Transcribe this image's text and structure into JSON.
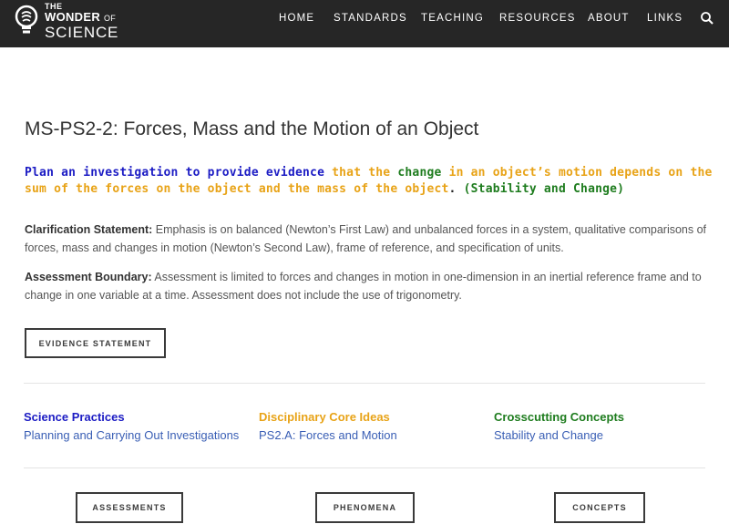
{
  "header": {
    "logo": {
      "line1": "THE",
      "line2": "WONDER",
      "line2_of": "OF",
      "line3": "SCIENCE"
    },
    "nav": [
      {
        "label": "HOME"
      },
      {
        "label": "STANDARDS"
      },
      {
        "label": "TEACHING"
      },
      {
        "label": "RESOURCES"
      },
      {
        "label": "ABOUT"
      },
      {
        "label": "LINKS"
      }
    ],
    "search_icon": "search-icon"
  },
  "page": {
    "title": "MS-PS2-2: Forces, Mass and the Motion of an Object",
    "performance_expectation": {
      "part1": "Plan an investigation to provide evidence",
      "part2": " that the ",
      "part3": "change",
      "part4": " in an object’s motion depends on the sum of the forces on the object and the mass of the object",
      "part5": ". ",
      "part6": "(Stability and Change)"
    },
    "clarification": {
      "label": "Clarification Statement:",
      "text": " Emphasis is on balanced (Newton’s First Law) and unbalanced forces in a system, qualitative comparisons of forces, mass and changes in motion (Newton’s Second Law), frame of reference, and specification of units."
    },
    "assessment_boundary": {
      "label": "Assessment Boundary:",
      "text": " Assessment is limited to forces and changes in motion in one-dimension in an inertial reference frame and to change in one variable at a time. Assessment does not include the use of trigonometry."
    },
    "evidence_button": "EVIDENCE STATEMENT",
    "columns": [
      {
        "heading": "Science Practices",
        "link": "Planning and Carrying Out Investigations",
        "color": "#1c1cc4"
      },
      {
        "heading": "Disciplinary Core Ideas",
        "link": "PS2.A: Forces and Motion",
        "color": "#e8a317"
      },
      {
        "heading": "Crosscutting Concepts",
        "link": "Stability and Change",
        "color": "#1e7c1e"
      }
    ],
    "bottom_buttons": [
      {
        "label": "ASSESSMENTS"
      },
      {
        "label": "PHENOMENA"
      },
      {
        "label": "CONCEPTS"
      }
    ]
  },
  "colors": {
    "nav_bg": "#262626",
    "link": "#3a5fb5",
    "pe_blue": "#1c1cc4",
    "pe_orange": "#e8a317",
    "pe_green": "#1e7c1e"
  }
}
